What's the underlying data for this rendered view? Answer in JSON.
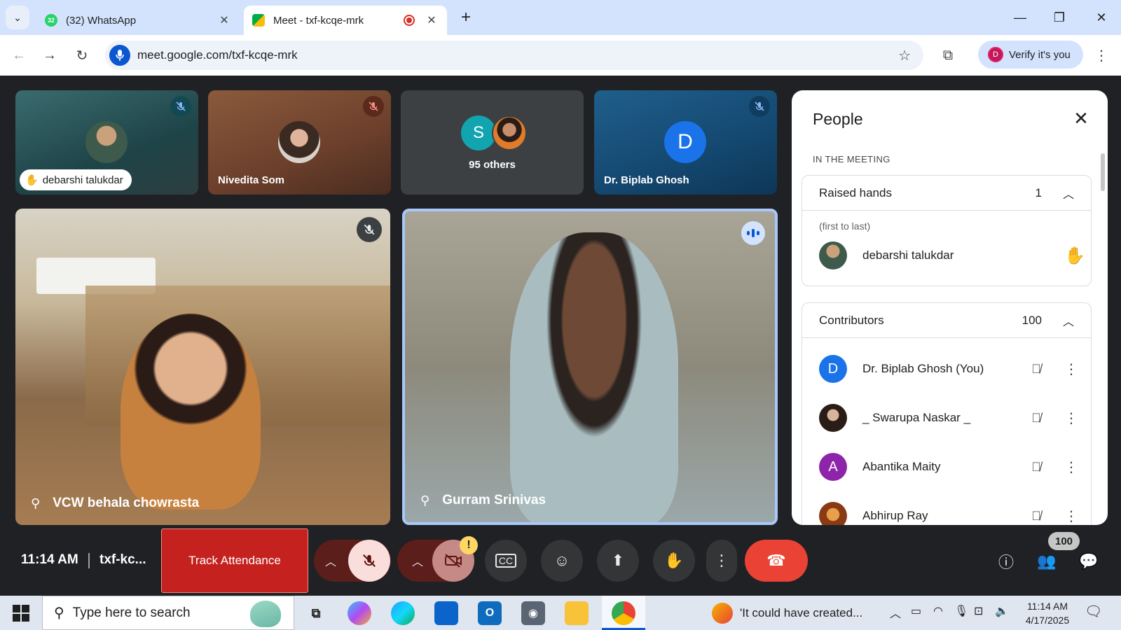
{
  "browser": {
    "tabs": [
      {
        "label": "(32) WhatsApp",
        "favicon_badge": "32",
        "active": false
      },
      {
        "label": "Meet - txf-kcqe-mrk",
        "active": true,
        "recording": true
      }
    ],
    "url": "meet.google.com/txf-kcqe-mrk",
    "profile_button": "Verify it's you",
    "profile_initial": "D",
    "tab_close_glyph": "✕",
    "new_tab_glyph": "+"
  },
  "meet": {
    "top_tiles": [
      {
        "name": "debarshi talukdar",
        "hand_raised": true,
        "muted": true
      },
      {
        "name": "Nivedita Som",
        "muted": true
      },
      {
        "others_label": "95 others",
        "initial": "S"
      },
      {
        "name": "Dr. Biplab Ghosh",
        "initial": "D",
        "muted": true
      }
    ],
    "main_tiles": [
      {
        "name": "VCW behala chowrasta",
        "muted": true,
        "pinned_glyph": "📌"
      },
      {
        "name": "Gurram Srinivas",
        "speaking": true
      }
    ]
  },
  "people_panel": {
    "title": "People",
    "section_label": "IN THE MEETING",
    "raised_hands": {
      "label": "Raised hands",
      "count": "1",
      "order_note": "(first to last)",
      "people": [
        {
          "name": "debarshi talukdar"
        }
      ]
    },
    "contributors": {
      "label": "Contributors",
      "count": "100",
      "people": [
        {
          "name": "Dr. Biplab Ghosh (You)",
          "initial": "D",
          "color": "#1a73e8"
        },
        {
          "name": "_ Swarupa Naskar _",
          "initial": "",
          "color": "#5f4b46"
        },
        {
          "name": "Abantika Maity",
          "initial": "A",
          "color": "#8e24aa"
        },
        {
          "name": "Abhirup Ray",
          "initial": "",
          "color": "#b5651d"
        }
      ]
    }
  },
  "controls": {
    "time": "11:14 AM",
    "meeting_code": "txf-kc...",
    "track_attendance": "Track Attendance",
    "participants_badge": "100",
    "camera_warning": "!"
  },
  "taskbar": {
    "search_placeholder": "Type here to search",
    "notification_text": "'It could have created...",
    "clock_time": "11:14 AM",
    "clock_date": "4/17/2025"
  },
  "colors": {
    "meet_bg": "#202124",
    "accent": "#0b57d0",
    "end_call": "#ea4335",
    "track_attendance": "#c5221f"
  }
}
